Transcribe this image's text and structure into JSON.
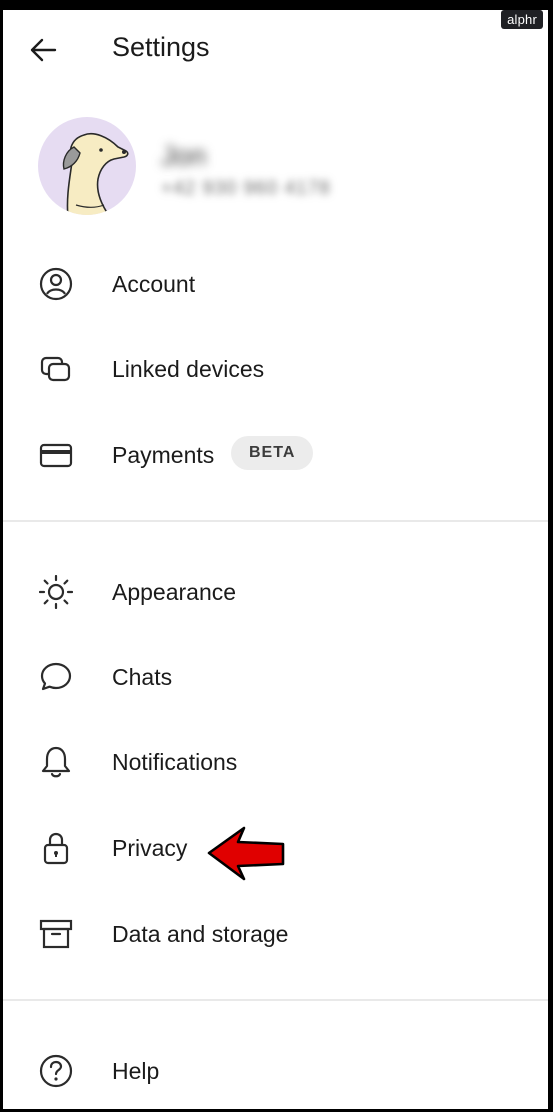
{
  "watermark": "alphr",
  "header": {
    "title": "Settings"
  },
  "profile": {
    "name": "Jon",
    "phone": "+42 930 960 4178"
  },
  "menu": {
    "account": "Account",
    "linked_devices": "Linked devices",
    "payments": "Payments",
    "payments_badge": "BETA",
    "appearance": "Appearance",
    "chats": "Chats",
    "notifications": "Notifications",
    "privacy": "Privacy",
    "data_storage": "Data and storage",
    "help": "Help"
  },
  "colors": {
    "annotation_arrow": "#e00000",
    "avatar_bg": "#e6dcf2"
  },
  "icons": [
    "back-arrow-icon",
    "person-circle-icon",
    "linked-devices-icon",
    "credit-card-icon",
    "sun-icon",
    "chat-bubble-icon",
    "bell-icon",
    "lock-icon",
    "archive-box-icon",
    "help-circle-icon"
  ]
}
